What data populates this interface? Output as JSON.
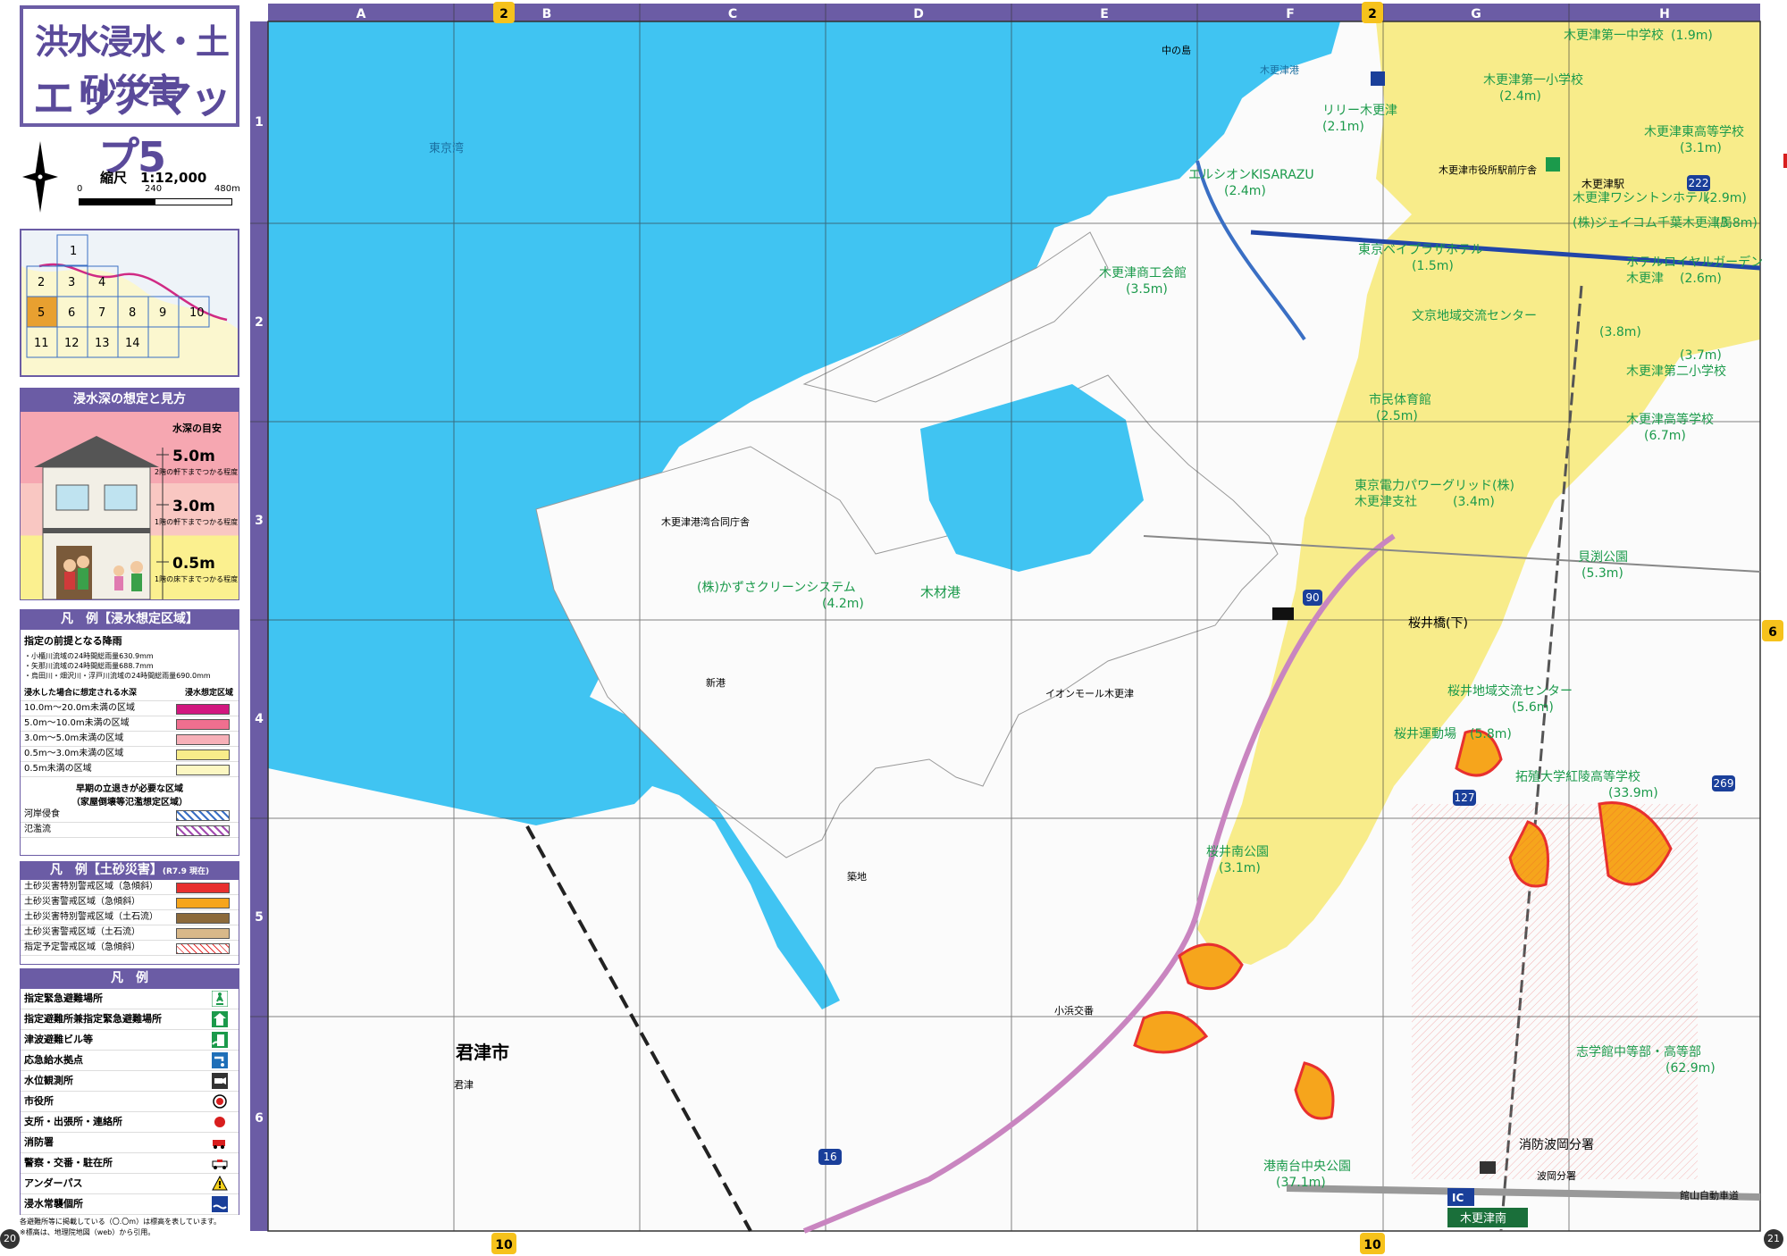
{
  "title": {
    "line1": "洪水浸水・土砂災害",
    "line2": "エリアマップ5"
  },
  "scale": {
    "label": "縮尺　1:12,000",
    "ticks": [
      "0",
      "240",
      "480m"
    ]
  },
  "index_map": {
    "cells": [
      "1",
      "2",
      "3",
      "4",
      "5",
      "6",
      "7",
      "8",
      "9",
      "10",
      "11",
      "12",
      "13",
      "14"
    ],
    "current": "5"
  },
  "depth_section": {
    "heading": "浸水深の想定と見方",
    "guide_label": "水深の目安",
    "levels": [
      {
        "value": "5.0m",
        "note": "2階の軒下までつかる程度"
      },
      {
        "value": "3.0m",
        "note": "1階の軒下までつかる程度"
      },
      {
        "value": "0.5m",
        "note": "1階の床下までつかる程度"
      }
    ]
  },
  "flood_legend": {
    "heading": "凡　例【浸水想定区域】",
    "rain_title": "指定の前提となる降雨",
    "rain_notes": [
      "・小櫃川流域の24時間総雨量630.9mm",
      "・矢那川流域の24時間総雨量688.7mm",
      "・烏田川・畑沢川・浮戸川流域の24時間総雨量690.0mm"
    ],
    "col1": "浸水した場合に想定される水深",
    "col2": "浸水想定区域",
    "rows": [
      {
        "label": "10.0m～20.0m未満の区域",
        "color": "#d2177f"
      },
      {
        "label": "5.0m～10.0m未満の区域",
        "color": "#ef6f8f"
      },
      {
        "label": "3.0m～5.0m未満の区域",
        "color": "#f7b0b8"
      },
      {
        "label": "0.5m～3.0m未満の区域",
        "color": "#f8ec8a"
      },
      {
        "label": "0.5m未満の区域",
        "color": "#fcf7c2"
      }
    ],
    "evac_title": "早期の立退きが必要な区域",
    "evac_sub": "（家屋倒壊等氾濫想定区域）",
    "evac_rows": [
      {
        "label": "河岸侵食",
        "color": "#3a6fc4"
      },
      {
        "label": "氾濫流",
        "color": "#a34bb0"
      }
    ]
  },
  "landslide_legend": {
    "heading": "凡　例【土砂災害】",
    "heading_note": "(R7.9 現在)",
    "rows": [
      {
        "label": "土砂災害特別警戒区域（急傾斜）",
        "color": "#e8302f"
      },
      {
        "label": "土砂災害警戒区域（急傾斜）",
        "color": "#f6a51c"
      },
      {
        "label": "土砂災害特別警戒区域（土石流）",
        "color": "#8c6a3b"
      },
      {
        "label": "土砂災害警戒区域（土石流）",
        "color": "#d8b889"
      },
      {
        "label": "指定予定警戒区域（急傾斜）",
        "color": "#f3b8b8"
      }
    ]
  },
  "symbol_legend": {
    "heading": "凡　例",
    "rows": [
      {
        "label": "指定緊急避難場所",
        "icon": "emergency-evacuation-icon"
      },
      {
        "label": "指定避難所兼指定緊急避難場所",
        "icon": "shelter-evacuation-icon"
      },
      {
        "label": "津波避難ビル等",
        "icon": "tsunami-building-icon"
      },
      {
        "label": "応急給水拠点",
        "icon": "water-supply-icon"
      },
      {
        "label": "水位観測所",
        "icon": "water-gauge-icon"
      },
      {
        "label": "市役所",
        "icon": "city-hall-icon"
      },
      {
        "label": "支所・出張所・連絡所",
        "icon": "branch-office-icon"
      },
      {
        "label": "消防署",
        "icon": "fire-station-icon"
      },
      {
        "label": "警察・交番・駐在所",
        "icon": "police-icon"
      },
      {
        "label": "アンダーパス",
        "icon": "underpass-icon"
      },
      {
        "label": "浸水常襲個所",
        "icon": "flood-prone-icon"
      }
    ],
    "footnote1": "各避難所等に掲載している（〇.〇m）は標高を表しています。",
    "footnote2": "※標高は、地理院地図（web）から引用。"
  },
  "page_numbers": {
    "left": "20",
    "right": "21"
  },
  "grid": {
    "columns": [
      "A",
      "B",
      "C",
      "D",
      "E",
      "F",
      "G",
      "H"
    ],
    "rows": [
      "1",
      "2",
      "3",
      "4",
      "5",
      "6"
    ],
    "adjacent": {
      "top_b": "2",
      "top_g": "2",
      "right": "6",
      "bottom_b": "10",
      "bottom_g": "10"
    }
  },
  "map_labels": {
    "tokyo_bay": "東京湾",
    "kimitsu": "君津市",
    "kimitsu_small": "君津",
    "aeon": "イオンモール木更津",
    "port_office": "木更津港湾合同庁舎",
    "kazusa_clean": "(株)かずさクリーンシステム",
    "kazusa_clean_h": "(4.2m)",
    "shokokai": "木更津商工会館",
    "shokokai_h": "(3.5m)",
    "elcion": "エルシオンKISARAZU",
    "elcion_h": "(2.4m)",
    "lily": "リリー木更津",
    "lily_h": "(2.1m)",
    "bayplaza": "東京ベイプラザホテル",
    "bayplaza_h": "(1.5m)",
    "shimin_gym": "市民体育館",
    "shimin_gym_h": "(2.5m)",
    "tepco": "東京電力パワーグリッド(株)",
    "tepco2": "木更津支社",
    "tepco_h": "(3.4m)",
    "sakurai_bridge": "桜井橋(下)",
    "sakurai_center": "桜井地域交流センター",
    "sakurai_center_h": "(5.6m)",
    "sakurai_ground": "桜井運動場",
    "sakurai_ground_h": "(5.8m)",
    "sakurai_minami": "桜井南公園",
    "sakurai_minami_h": "(3.1m)",
    "takushoku": "拓殖大学紅陵高等学校",
    "takushoku_h": "(33.9m)",
    "shigakukan": "志学館中等部・高等部",
    "shigakukan_h": "(62.9m)",
    "konandai": "港南台中央公園",
    "konandai_h": "(37.1m)",
    "kaibuchi": "貝渕公園",
    "kaibuchi_h": "(5.3m)",
    "bunkyo": "文京地域交流センター",
    "bunkyo_h": "(3.8m)",
    "daiichi_chu": "木更津第一中学校",
    "daiichi_chu_h": "(1.9m)",
    "daiichi_sho": "木更津第一小学校",
    "daiichi_sho_h": "(2.4m)",
    "higashi_hs": "木更津東高等学校",
    "higashi_hs_h": "(3.1m)",
    "washington": "木更津ワシントンホテル",
    "washington_h": "(2.9m)",
    "jcom": "(株)ジェイコム千葉木更津局",
    "jcom_h": "(3.8m)",
    "royal": "ホテルロイヤルガーデン",
    "royal2": "木更津",
    "royal_h": "(2.6m)",
    "daini_sho": "木更津第二小学校",
    "daini_sho_h": "(3.7m)",
    "kisarazu_hs": "木更津高等学校",
    "kisarazu_hs_h": "(6.7m)",
    "fire_hatoka": "消防波岡分署",
    "hatoka_small": "波岡分署",
    "kisarazu_station": "木更津駅",
    "kisarazu_minami": "木更津南",
    "city_office": "木更津市役所駅前庁舎",
    "kisarazu_port": "木更津港",
    "nakanoshima": "中の島",
    "mokuzai": "木材港",
    "shinko": "新港",
    "tsukiji": "築地",
    "ohamakotsu": "小浜交番",
    "expressway": "館山自動車道",
    "ic": "IC"
  },
  "route_numbers": [
    "16",
    "90",
    "127",
    "222",
    "269"
  ],
  "colors": {
    "sea": "#40c4f2",
    "flood_shallow": "#f8ec8a",
    "frame": "#6b5ca5",
    "shelter_green": "#1b9a4b",
    "landslide_red": "#e8302f"
  }
}
